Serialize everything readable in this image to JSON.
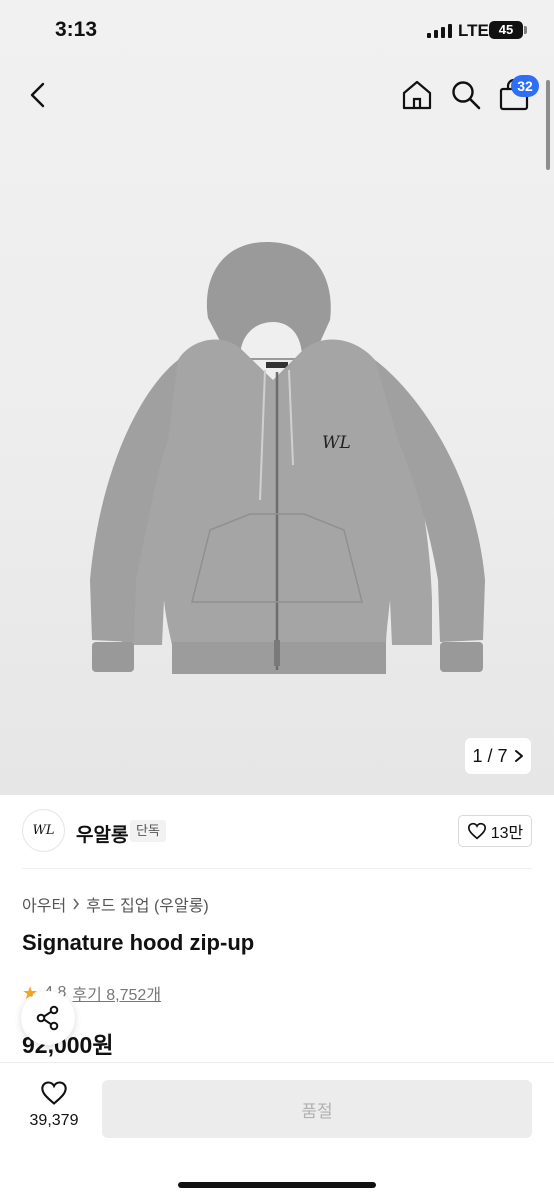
{
  "status_bar": {
    "time": "3:13",
    "network": "LTE",
    "battery": "45"
  },
  "nav": {
    "cart_count": "32"
  },
  "gallery": {
    "pager_label": "1 / 7"
  },
  "brand": {
    "logo_text": "WL",
    "name": "우알롱",
    "tag": "단독",
    "likes": "13만"
  },
  "breadcrumb": {
    "category": "아우터",
    "subcategory": "후드 집업 (우알롱)"
  },
  "product": {
    "title": "Signature hood zip-up",
    "rating": "4.8",
    "reviews": "후기 8,752개",
    "price": "92,000원"
  },
  "bottom": {
    "wish_count": "39,379",
    "buy_label": "품절"
  },
  "icons": [
    "back-icon",
    "home-icon",
    "search-icon",
    "bag-icon",
    "chevron-right-icon",
    "heart-icon",
    "share-icon",
    "star-icon"
  ],
  "colors": {
    "accent": "#2f6ff3",
    "star": "#f5a623",
    "disabled": "#ececec"
  }
}
